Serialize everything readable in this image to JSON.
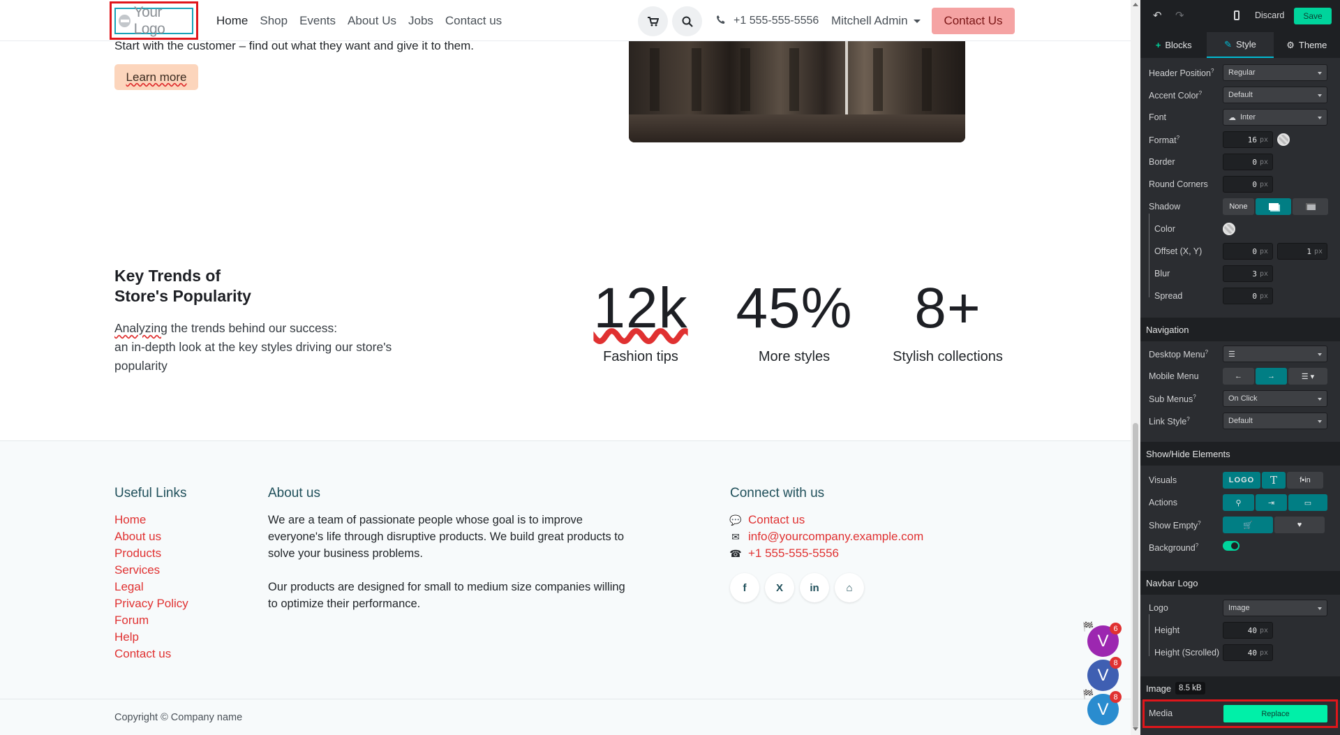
{
  "navbar": {
    "logo_text": "Your Logo",
    "links": [
      "Home",
      "Shop",
      "Events",
      "About Us",
      "Jobs",
      "Contact us"
    ],
    "phone": "+1 555-555-5556",
    "user": "Mitchell Admin",
    "cta": "Contact Us"
  },
  "hero": {
    "text": "Start with the customer – find out what they want and give it to them.",
    "button": "Learn more"
  },
  "trends": {
    "title_line1": "Key Trends of",
    "title_line2": "Store's Popularity",
    "text_word": "Analyzing",
    "text_rest": " the trends behind our success:",
    "text_line2": "an in-depth look at the key styles driving our store's popularity",
    "stats": [
      {
        "value": "12k",
        "label": "Fashion tips"
      },
      {
        "value": "45%",
        "label": "More styles"
      },
      {
        "value": "8+",
        "label": "Stylish collections"
      }
    ]
  },
  "footer": {
    "useful_links_title": "Useful Links",
    "useful_links": [
      "Home",
      "About us",
      "Products",
      "Services",
      "Legal",
      "Privacy Policy",
      "Forum",
      "Help",
      "Contact us"
    ],
    "about_title": "About us",
    "about_p1": "We are a team of passionate people whose goal is to improve everyone's life through disruptive products. We build great products to solve your business problems.",
    "about_p2": "Our products are designed for small to medium size companies willing to optimize their performance.",
    "connect_title": "Connect with us",
    "connect_contact": "Contact us",
    "connect_email": "info@yourcompany.example.com",
    "connect_phone": "+1 555-555-5556",
    "social": [
      "f",
      "X",
      "in",
      "⌂"
    ],
    "copyright": "Copyright © Company name"
  },
  "avatars": [
    {
      "letter": "V",
      "badge": "6",
      "color": "#9c27b0"
    },
    {
      "letter": "V",
      "badge": "8",
      "color": "#3f5fb2"
    },
    {
      "letter": "V",
      "badge": "8",
      "color": "#2a8ccf"
    }
  ],
  "editor": {
    "discard": "Discard",
    "save": "Save",
    "tabs": [
      "Blocks",
      "Style",
      "Theme"
    ],
    "header_position_label": "Header Position",
    "header_position": "Regular",
    "accent_color_label": "Accent Color",
    "accent_color": "Default",
    "font_label": "Font",
    "font": "Inter",
    "format_label": "Format",
    "format": "16",
    "border_label": "Border",
    "border": "0",
    "round_corners_label": "Round Corners",
    "round_corners": "0",
    "shadow_label": "Shadow",
    "shadow_none": "None",
    "color_label": "Color",
    "offset_label": "Offset (X, Y)",
    "offset_x": "0",
    "offset_y": "1",
    "blur_label": "Blur",
    "blur": "3",
    "spread_label": "Spread",
    "spread": "0",
    "unit": "px",
    "navigation_title": "Navigation",
    "desktop_menu_label": "Desktop Menu",
    "mobile_menu_label": "Mobile Menu",
    "sub_menus_label": "Sub Menus",
    "sub_menus": "On Click",
    "link_style_label": "Link Style",
    "link_style": "Default",
    "show_hide_title": "Show/Hide Elements",
    "visuals_label": "Visuals",
    "visuals_logo": "LOGO",
    "actions_label": "Actions",
    "show_empty_label": "Show Empty",
    "background_label": "Background",
    "navbar_logo_title": "Navbar Logo",
    "logo_label": "Logo",
    "logo": "Image",
    "height_label": "Height",
    "height": "40",
    "height_scrolled_label": "Height (Scrolled)",
    "height_scrolled": "40",
    "image_label": "Image",
    "image_size": "8.5 kB",
    "media_label": "Media",
    "replace": "Replace"
  }
}
